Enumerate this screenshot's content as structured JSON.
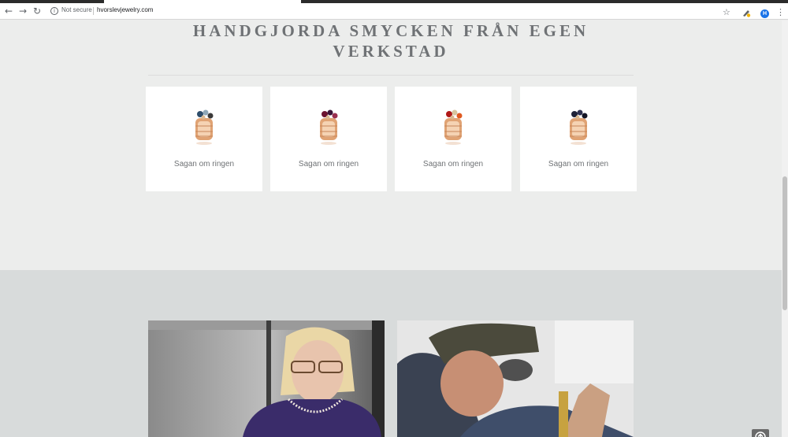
{
  "browser": {
    "security_label": "Not secure",
    "url": "hvorslevjewelry.com",
    "profile_initial": "H",
    "icons": {
      "back": "arrow-left-icon",
      "forward": "arrow-right-icon",
      "reload": "reload-icon",
      "info": "info-icon",
      "bookmark": "star-icon",
      "extension": "pencil-extension-icon",
      "menu": "vertical-dots-icon"
    }
  },
  "page": {
    "heading": "HANDGJORDA SMYCKEN FRÅN EGEN VERKSTAD",
    "products": [
      {
        "label": "Sagan om ringen",
        "gem_colors": [
          "#2e4d6b",
          "#8fa8b8",
          "#3a3a3a"
        ]
      },
      {
        "label": "Sagan om ringen",
        "gem_colors": [
          "#6b1230",
          "#3a1538",
          "#9a3050"
        ]
      },
      {
        "label": "Sagan om ringen",
        "gem_colors": [
          "#b01818",
          "#d8c6a0",
          "#e05a20"
        ]
      },
      {
        "label": "Sagan om ringen",
        "gem_colors": [
          "#1e2238",
          "#2e3150",
          "#141626"
        ]
      }
    ]
  },
  "colors": {
    "background_light": "#ecedec",
    "background_dark": "#d8dbdb",
    "text_muted": "#6f7275",
    "gold": "#e0a374"
  }
}
